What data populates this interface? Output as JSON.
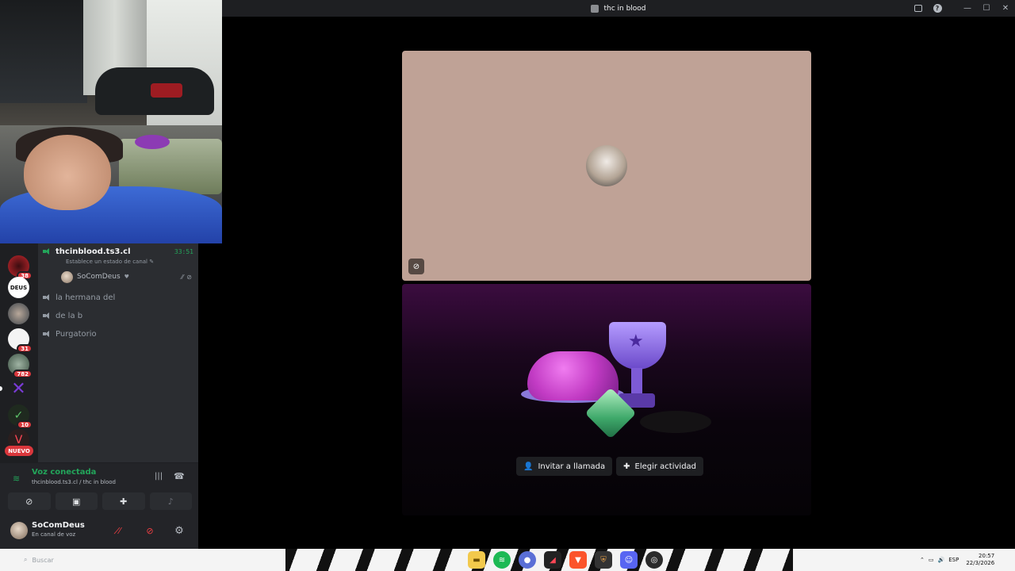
{
  "window": {
    "title": "thc in blood",
    "controls": {
      "inbox_icon": "inbox-icon",
      "help_icon": "help-icon",
      "minimize": "—",
      "maximize": "☐",
      "close": "✕"
    }
  },
  "servers": [
    {
      "name": "server-1",
      "badge": "38",
      "color": "#c1272d"
    },
    {
      "name": "server-deus",
      "label": "DEUS",
      "color": "#ffffff"
    },
    {
      "name": "server-3",
      "color": "#5a6a7a"
    },
    {
      "name": "server-4",
      "badge": "31",
      "color": "#eeeeee"
    },
    {
      "name": "server-5",
      "badge": "782",
      "color": "#4f6b57"
    },
    {
      "name": "server-6",
      "color": "#7a3bd6"
    },
    {
      "name": "server-7",
      "badge": "10",
      "color": "#1f2a1f"
    },
    {
      "name": "server-8",
      "color": "#2a1e1e"
    }
  ],
  "rail": {
    "new_label": "NUEVO"
  },
  "channels": {
    "active_voice": {
      "name": "thcinblood.ts3.cl",
      "timer": "33:51",
      "status": "Establece un estado de canal",
      "member": "SoComDeus"
    },
    "items": [
      {
        "label": "la hermana del"
      },
      {
        "label": "de la b"
      },
      {
        "label": "Purgatorio"
      }
    ]
  },
  "voice_panel": {
    "title": "Voz conectada",
    "subtitle": "thcinblood.ts3.cl / thc in blood",
    "buttons": [
      "camera-off",
      "screen-share",
      "activities",
      "soundboard"
    ]
  },
  "user_panel": {
    "name": "SoComDeus",
    "status": "En canal de voz"
  },
  "stage": {
    "invite_label": "Invitar a llamada",
    "activity_label": "Elegir actividad"
  },
  "taskbar": {
    "search_placeholder": "Buscar",
    "language": "ESP",
    "time": "20:57",
    "date": "22/3/2026"
  }
}
